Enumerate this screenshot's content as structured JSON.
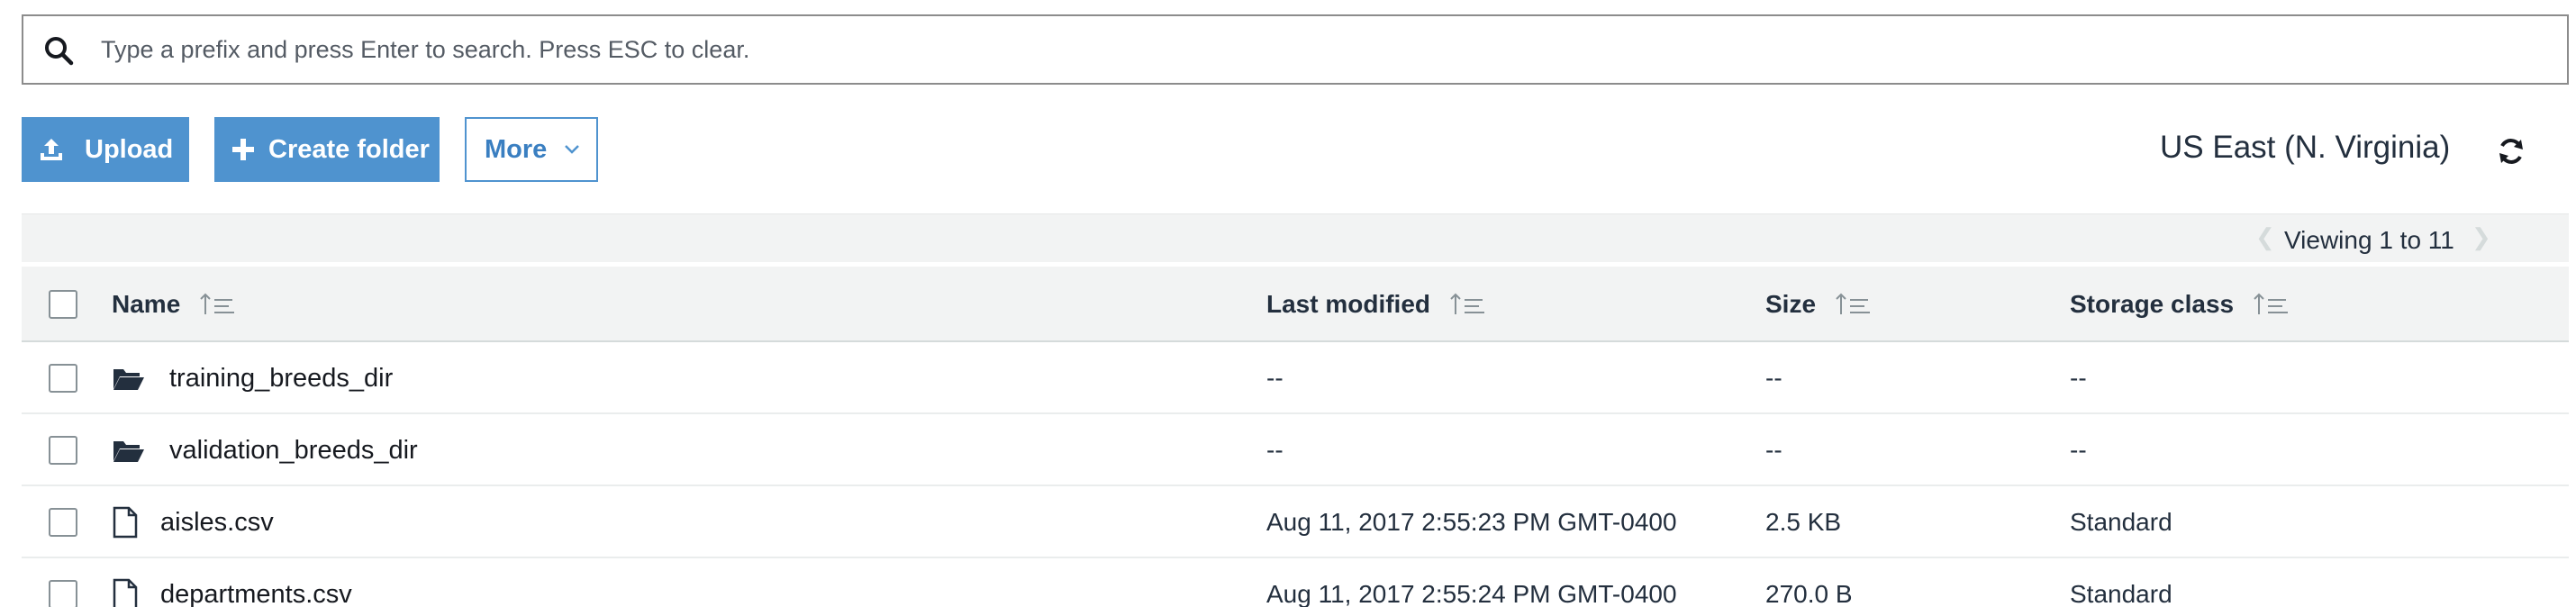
{
  "search": {
    "icon": "search-icon",
    "placeholder": "Type a prefix and press Enter to search. Press ESC to clear."
  },
  "toolbar": {
    "upload_label": "Upload",
    "create_folder_label": "Create folder",
    "more_label": "More",
    "region": "US East (N. Virginia)"
  },
  "pagination": {
    "viewing": "Viewing 1 to 11"
  },
  "table": {
    "columns": {
      "name": "Name",
      "last_modified": "Last modified",
      "size": "Size",
      "storage_class": "Storage class"
    },
    "rows": [
      {
        "type": "folder",
        "name": "training_breeds_dir",
        "last_modified": "--",
        "size": "--",
        "storage_class": "--"
      },
      {
        "type": "folder",
        "name": "validation_breeds_dir",
        "last_modified": "--",
        "size": "--",
        "storage_class": "--"
      },
      {
        "type": "file",
        "name": "aisles.csv",
        "last_modified": "Aug 11, 2017 2:55:23 PM GMT-0400",
        "size": "2.5 KB",
        "storage_class": "Standard"
      },
      {
        "type": "file",
        "name": "departments.csv",
        "last_modified": "Aug 11, 2017 2:55:24 PM GMT-0400",
        "size": "270.0 B",
        "storage_class": "Standard"
      }
    ]
  },
  "colors": {
    "primary": "#4f93cf",
    "header_bg": "#f2f3f3",
    "text": "#232f3e"
  }
}
